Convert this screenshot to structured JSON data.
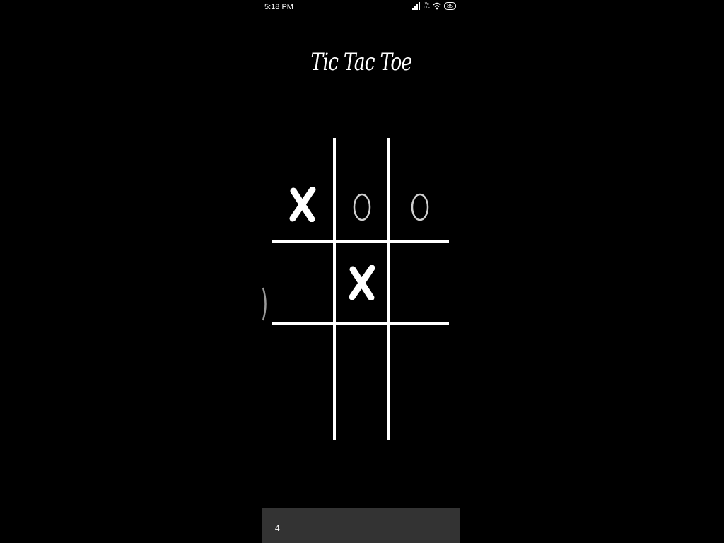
{
  "status_bar": {
    "time": "5:18 PM",
    "dots": "....",
    "volte_top": "Vo",
    "volte_bottom": "LTE",
    "battery": "85",
    "icons": [
      "signal-icon",
      "volte-icon",
      "wifi-icon",
      "battery-icon"
    ]
  },
  "app": {
    "title": "Tic Tac Toe"
  },
  "board": {
    "cells": [
      [
        "X",
        "O",
        "O"
      ],
      [
        "",
        "X",
        ""
      ],
      [
        "",
        "",
        ""
      ]
    ]
  },
  "bottom_bar": {
    "text": "4"
  },
  "colors": {
    "background": "#000000",
    "foreground": "#ffffff",
    "o_mark": "#cfcfcf",
    "bottom_bar": "#333333"
  }
}
